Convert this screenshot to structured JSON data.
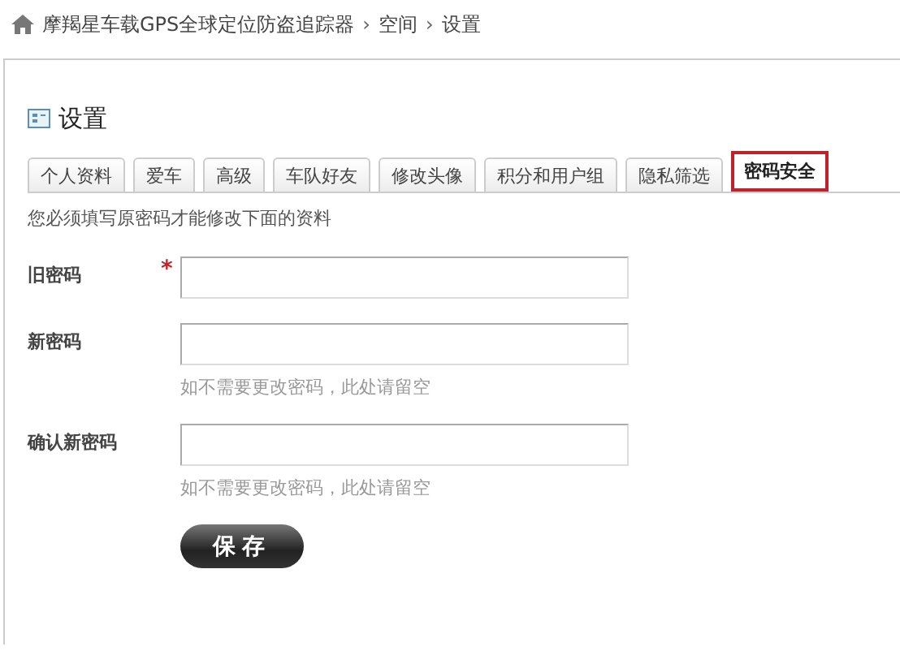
{
  "breadcrumb": [
    {
      "kind": "link",
      "text": "摩羯星车载GPS全球定位防盗追踪器"
    },
    {
      "kind": "separator",
      "text": "›"
    },
    {
      "kind": "link",
      "text": "空间"
    },
    {
      "kind": "separator",
      "text": "›"
    },
    {
      "kind": "link",
      "text": "设置"
    }
  ],
  "title": "设置",
  "tabs": [
    {
      "label": "个人资料",
      "selected": false
    },
    {
      "label": "爱车",
      "selected": false
    },
    {
      "label": "高级",
      "selected": false
    },
    {
      "label": "车队好友",
      "selected": false
    },
    {
      "label": "修改头像",
      "selected": false
    },
    {
      "label": "积分和用户组",
      "selected": false
    },
    {
      "label": "隐私筛选",
      "selected": false
    },
    {
      "label": "密码安全",
      "selected": true
    }
  ],
  "notice": "您必须填写原密码才能修改下面的资料",
  "fields": [
    {
      "label": "旧密码",
      "required_mark": "*"
    },
    {
      "label": "新密码",
      "hint": "如不需要更改密码，此处请留空"
    },
    {
      "label": "确认新密码",
      "hint": "如不需要更改密码，此处请留空"
    }
  ],
  "save_button": "保存"
}
